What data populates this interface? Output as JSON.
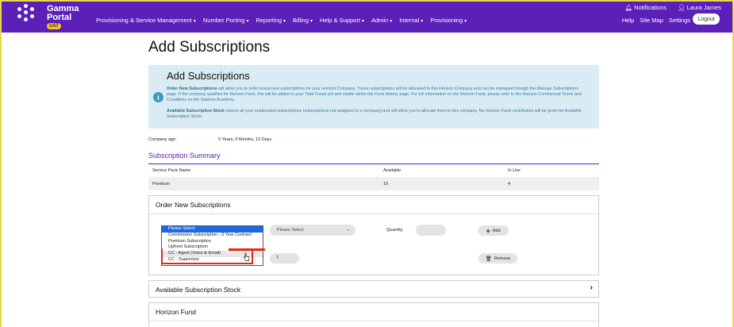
{
  "header": {
    "brand_line1": "Gamma",
    "brand_line2": "Portal",
    "env_badge": "UAT",
    "nav": [
      {
        "label": "Provisioning & Service Management"
      },
      {
        "label": "Number Porting"
      },
      {
        "label": "Reporting"
      },
      {
        "label": "Billing"
      },
      {
        "label": "Help & Support"
      },
      {
        "label": "Admin"
      },
      {
        "label": "Internal"
      },
      {
        "label": "Provisioning"
      }
    ],
    "notifications": "Notifications",
    "user": "Laura James",
    "help": "Help",
    "site_map": "Site Map",
    "settings": "Settings",
    "logout": "Logout"
  },
  "page": {
    "title": "Add Subscriptions"
  },
  "info": {
    "title": "Add Subscriptions",
    "p1_bold": "Order New Subscriptions",
    "p1_text": " will allow you to order brand new subscriptions for your Horizon Company. These subscriptions will be allocated to this Horizon Company and can be managed through the Manage Subscriptions page. If the company qualifies for Horizon Fund, this will be added to your Total Funds pot and visible within the Fund History page. For full information on the Horizon Fund, please refer to the Horizon Commercial Terms and Conditions on the Gamma Academy.",
    "p2_bold": "Available Subscription Stock",
    "p2_text": " returns all your unallocated subscriptions (subscriptions not assigned to a company) and will allow you to allocate them to this company. No Horizon Fund contribution will be given for Available Subscription Stock."
  },
  "company_age": {
    "label": "Company age:",
    "value": "0 Years, 0 Months, 13 Days"
  },
  "summary": {
    "title": "Subscription Summary",
    "headers": [
      "Service Pack Name",
      "Available",
      "In Use"
    ],
    "rows": [
      [
        "Premium",
        "10",
        "4"
      ]
    ]
  },
  "order": {
    "title": "Order New Subscriptions",
    "options": [
      "Please Select",
      "Commission Subscription - 3 Year Contract",
      "Premium Subscription",
      "Upfront Subscription",
      "CC - Agent (Voice & Email)",
      "CC - Supervisor"
    ],
    "selected_index": 0,
    "hover_index": 4,
    "second_select": "Please Select",
    "quantity_label": "Quantity",
    "quantity_value": "",
    "add_label": "Add",
    "row2_quantity": "7",
    "remove_label": "Remove"
  },
  "stock": {
    "title": "Available Subscription Stock"
  },
  "fund": {
    "title": "Horizon Fund"
  },
  "colors": {
    "header_bg": "#5a20b8",
    "accent": "#5a20b8",
    "info_bg": "#d9ebf3",
    "highlight": "#e02a1a"
  }
}
